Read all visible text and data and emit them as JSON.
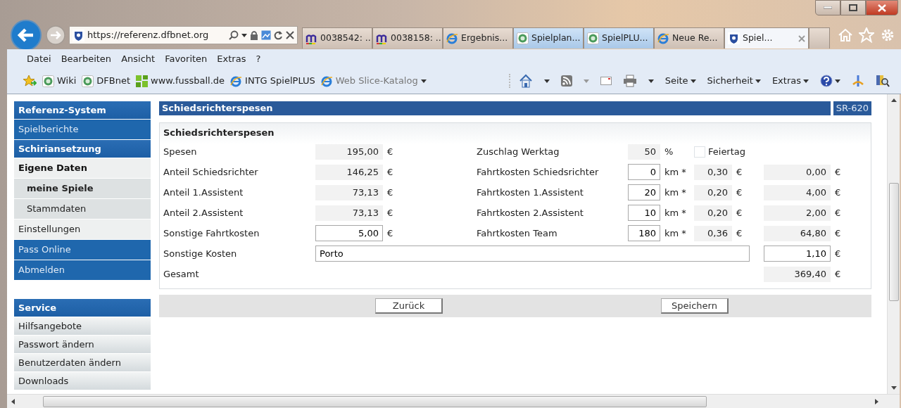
{
  "browser": {
    "address": "https://referenz.dfbnet.org",
    "tabs": [
      {
        "label": "0038542: ...",
        "kind": "mantis",
        "group": false,
        "selected": false
      },
      {
        "label": "0038158: ...",
        "kind": "mantis",
        "group": false,
        "selected": false
      },
      {
        "label": "Ergebnis...",
        "kind": "ie",
        "group": false,
        "selected": false
      },
      {
        "label": "Spielplan...",
        "kind": "dfb",
        "group": true,
        "selected": false
      },
      {
        "label": "SpielPLU...",
        "kind": "dfb",
        "group": true,
        "selected": false
      },
      {
        "label": "Neue Re...",
        "kind": "ie",
        "group": false,
        "selected": false
      },
      {
        "label": "Spiel...",
        "kind": "site",
        "group": false,
        "selected": true
      }
    ],
    "menu": [
      "Datei",
      "Bearbeiten",
      "Ansicht",
      "Favoriten",
      "Extras",
      "?"
    ],
    "favorites": [
      {
        "label": "Wiki",
        "kind": "dfb",
        "dimmed": false,
        "dropdown": false
      },
      {
        "label": "DFBnet",
        "kind": "dfb",
        "dimmed": false,
        "dropdown": false
      },
      {
        "label": "www.fussball.de",
        "kind": "green",
        "dimmed": false,
        "dropdown": false
      },
      {
        "label": "INTG SpielPLUS",
        "kind": "ie",
        "dimmed": false,
        "dropdown": false
      },
      {
        "label": "Web Slice-Katalog",
        "kind": "ie",
        "dimmed": true,
        "dropdown": true
      }
    ],
    "commands": [
      "Seite",
      "Sicherheit",
      "Extras"
    ]
  },
  "sidebar": {
    "groups": [
      {
        "items": [
          {
            "label": "Referenz-System",
            "kind": "header"
          },
          {
            "label": "Spielberichte",
            "kind": "link"
          },
          {
            "label": "Schiriansetzung",
            "kind": "header"
          },
          {
            "label": "Eigene Daten",
            "kind": "section"
          },
          {
            "label": "meine Spiele",
            "kind": "sub-active"
          },
          {
            "label": "Stammdaten",
            "kind": "sub"
          },
          {
            "label": "Einstellungen",
            "kind": "plain"
          },
          {
            "label": "Pass Online",
            "kind": "link"
          },
          {
            "label": "Abmelden",
            "kind": "link"
          }
        ]
      },
      {
        "items": [
          {
            "label": "Service",
            "kind": "header"
          },
          {
            "label": "Hilfsangebote",
            "kind": "item"
          },
          {
            "label": "Passwort ändern",
            "kind": "item"
          },
          {
            "label": "Benutzerdaten ändern",
            "kind": "item"
          },
          {
            "label": "Downloads",
            "kind": "item"
          }
        ]
      }
    ]
  },
  "page": {
    "title": "Schiedsrichterspesen",
    "code": "SR-620",
    "form": {
      "title": "Schiedsrichterspesen",
      "rows": [
        {
          "label": "Spesen",
          "value": {
            "kind": "readonly",
            "text": "195,00"
          },
          "unit": "€",
          "extra_label": "Zuschlag Werktag",
          "km": {
            "kind": "readonly",
            "text": "50"
          },
          "km_unit": "%",
          "checkbox": {
            "label": "Feiertag",
            "checked": false
          }
        },
        {
          "label": "Anteil Schiedsrichter",
          "value": {
            "kind": "readonly",
            "text": "146,25"
          },
          "unit": "€",
          "extra_label": "Fahrtkosten Schiedsrichter",
          "km": {
            "kind": "input",
            "text": "0"
          },
          "km_unit": "km *",
          "rate": "0,30",
          "rate_unit": "€",
          "amount": {
            "kind": "readonly",
            "text": "0,00"
          },
          "amount_unit": "€"
        },
        {
          "label": "Anteil 1.Assistent",
          "value": {
            "kind": "readonly",
            "text": "73,13"
          },
          "unit": "€",
          "extra_label": "Fahrtkosten 1.Assistent",
          "km": {
            "kind": "input",
            "text": "20"
          },
          "km_unit": "km *",
          "rate": "0,20",
          "rate_unit": "€",
          "amount": {
            "kind": "readonly",
            "text": "4,00"
          },
          "amount_unit": "€"
        },
        {
          "label": "Anteil 2.Assistent",
          "value": {
            "kind": "readonly",
            "text": "73,13"
          },
          "unit": "€",
          "extra_label": "Fahrtkosten 2.Assistent",
          "km": {
            "kind": "input",
            "text": "10"
          },
          "km_unit": "km *",
          "rate": "0,20",
          "rate_unit": "€",
          "amount": {
            "kind": "readonly",
            "text": "2,00"
          },
          "amount_unit": "€"
        },
        {
          "label": "Sonstige Fahrtkosten",
          "value": {
            "kind": "input",
            "text": "5,00"
          },
          "unit": "€",
          "extra_label": "Fahrtkosten Team",
          "km": {
            "kind": "input",
            "text": "180"
          },
          "km_unit": "km *",
          "rate": "0,36",
          "rate_unit": "€",
          "amount": {
            "kind": "readonly",
            "text": "64,80"
          },
          "amount_unit": "€"
        },
        {
          "label": "Sonstige Kosten",
          "value": {
            "kind": "wide-input",
            "text": "Porto"
          },
          "amount": {
            "kind": "input",
            "text": "1,10"
          },
          "amount_unit": "€"
        },
        {
          "label": "Gesamt",
          "amount": {
            "kind": "readonly",
            "text": "369,40"
          },
          "amount_unit": "€"
        }
      ]
    },
    "buttons": [
      "Zurück",
      "Speichern"
    ]
  }
}
